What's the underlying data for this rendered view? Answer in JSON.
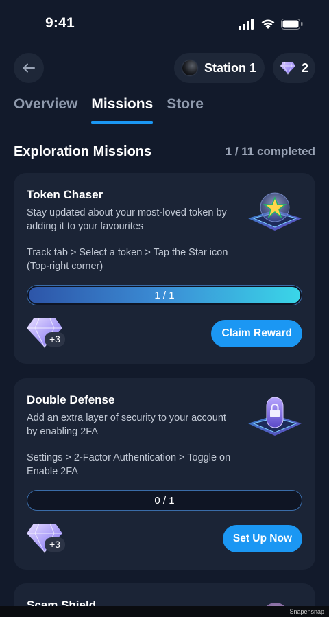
{
  "status_bar": {
    "time": "9:41"
  },
  "header": {
    "station_label": "Station 1",
    "gem_count": "2"
  },
  "tabs": [
    {
      "label": "Overview",
      "active": false
    },
    {
      "label": "Missions",
      "active": true
    },
    {
      "label": "Store",
      "active": false
    }
  ],
  "section": {
    "title": "Exploration Missions",
    "count": "1 / 11 completed"
  },
  "missions": [
    {
      "title": "Token Chaser",
      "description": "Stay updated about your most-loved token by adding it to your favourites",
      "steps": "Track tab > Select a token > Tap the Star icon (Top-right corner)",
      "progress_text": "1 / 1",
      "progress_fraction": 1.0,
      "reward": "+3",
      "button_label": "Claim Reward",
      "icon": "star-icon"
    },
    {
      "title": "Double Defense",
      "description": "Add an extra layer of security to your account by enabling 2FA",
      "steps": "Settings > 2-Factor Authentication > Toggle on Enable 2FA",
      "progress_text": "0 / 1",
      "progress_fraction": 0.0,
      "reward": "+3",
      "button_label": "Set Up Now",
      "icon": "lock-icon"
    },
    {
      "title": "Scam Shield"
    }
  ],
  "footer": {
    "watermark": "Snapensnap"
  },
  "colors": {
    "background": "#121a2b",
    "card": "#1b2436",
    "accent": "#1b97f3",
    "muted_text": "#8f9aad"
  }
}
